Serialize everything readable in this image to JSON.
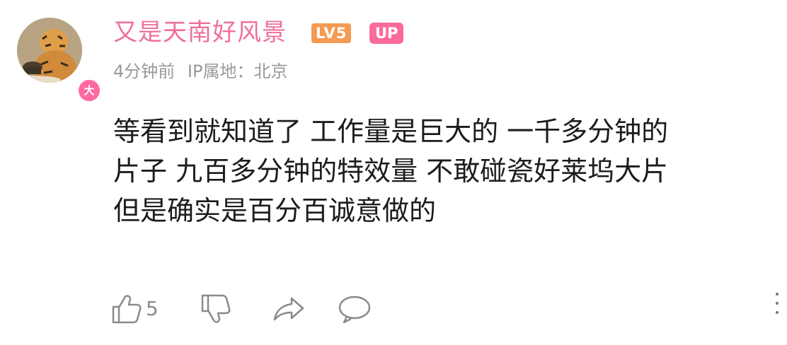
{
  "comment": {
    "avatar_badge": "大",
    "username": "又是天南好风景",
    "level": "LV5",
    "up_label": "UP",
    "time": "4分钟前",
    "ip_location": "IP属地：北京",
    "text_lines": [
      "等看到就知道了 工作量是巨大的 一千多分钟的",
      "片子 九百多分钟的特效量 不敢碰瓷好莱坞大片",
      "但是确实是百分百诚意做的"
    ],
    "like_count": "5",
    "icons": [
      "thumbs-up-icon",
      "thumbs-down-icon",
      "share-icon",
      "comment-icon",
      "more-icon"
    ],
    "colors": {
      "username": "#ef6f9c",
      "level_badge": "#f49a52",
      "up_badge": "#fa6b9a",
      "meta_text": "#9a9a9a",
      "body_text": "#1c1c1c"
    }
  }
}
